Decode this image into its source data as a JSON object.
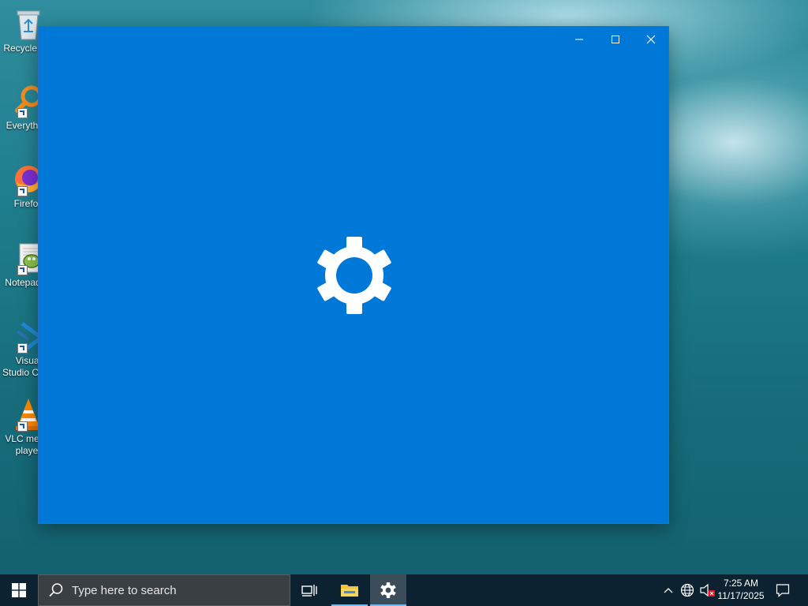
{
  "desktop": {
    "icons": [
      {
        "label": "Recycle Bin",
        "icon": "recycle-bin-icon"
      },
      {
        "label": "Everything",
        "icon": "everything-search-icon"
      },
      {
        "label": "Firefox",
        "icon": "firefox-icon"
      },
      {
        "label": "Notepad++",
        "icon": "notepadpp-icon"
      },
      {
        "label": "Visual Studio Code",
        "icon": "vscode-icon"
      },
      {
        "label": "VLC media player",
        "icon": "vlc-icon"
      }
    ]
  },
  "window": {
    "app": "Settings",
    "background_color": "#0078d7",
    "splash_icon": "gear-icon",
    "controls": [
      "minimize",
      "maximize",
      "close"
    ]
  },
  "taskbar": {
    "search_placeholder": "Type here to search",
    "pinned": [
      {
        "name": "Task View",
        "icon": "task-view-icon",
        "running": false
      },
      {
        "name": "File Explorer",
        "icon": "folder-icon",
        "running": true
      },
      {
        "name": "Settings",
        "icon": "gear-icon",
        "running": true,
        "active": true
      }
    ],
    "tray": {
      "icons": [
        "chevron-up-icon",
        "network-icon",
        "volume-muted-icon",
        "notification-icon"
      ]
    },
    "clock": {
      "time": "7:25 AM",
      "date": "11/17/2025"
    }
  },
  "colors": {
    "accent": "#0078d7",
    "taskbar": "#0c2230",
    "running_indicator": "#76b9ed"
  }
}
